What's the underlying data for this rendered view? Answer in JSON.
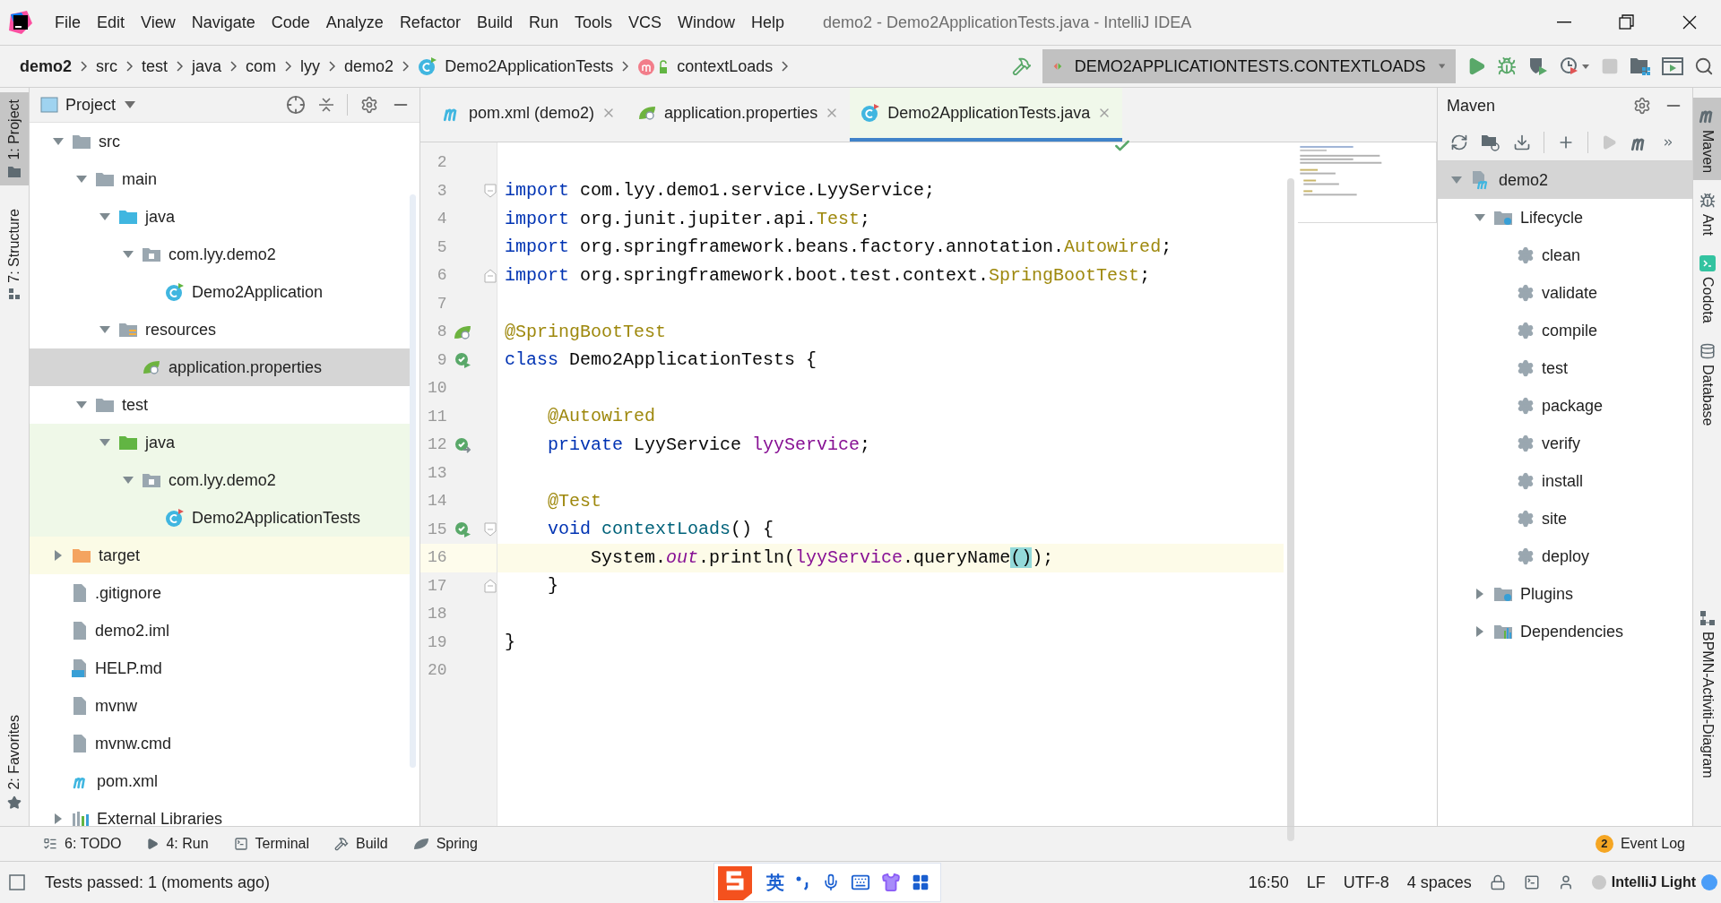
{
  "title_bar": {
    "title": "demo2 - Demo2ApplicationTests.java - IntelliJ IDEA"
  },
  "menu": [
    "File",
    "Edit",
    "View",
    "Navigate",
    "Code",
    "Analyze",
    "Refactor",
    "Build",
    "Run",
    "Tools",
    "VCS",
    "Window",
    "Help"
  ],
  "breadcrumbs": [
    {
      "label": "demo2",
      "kind": "project"
    },
    {
      "label": "src",
      "kind": "dir"
    },
    {
      "label": "test",
      "kind": "dir"
    },
    {
      "label": "java",
      "kind": "dir"
    },
    {
      "label": "com",
      "kind": "dir"
    },
    {
      "label": "lyy",
      "kind": "dir"
    },
    {
      "label": "demo2",
      "kind": "dir"
    },
    {
      "label": "Demo2ApplicationTests",
      "kind": "class"
    },
    {
      "label": "contextLoads",
      "kind": "method"
    }
  ],
  "run_config": {
    "label": "DEMO2APPLICATIONTESTS.CONTEXTLOADS"
  },
  "left_strip": [
    {
      "label": "1: Project",
      "kind": "project",
      "selected": true
    },
    {
      "label": "7: Structure",
      "kind": "structure",
      "selected": false
    },
    {
      "label": "2: Favorites",
      "kind": "favorites",
      "selected": false
    }
  ],
  "project_panel": {
    "title": "Project",
    "tree": [
      {
        "label": "src",
        "kind": "folder",
        "expanded": true,
        "selected": false,
        "children": [
          {
            "label": "main",
            "kind": "folder",
            "expanded": true,
            "selected": false,
            "children": [
              {
                "label": "java",
                "kind": "source-folder",
                "expanded": true,
                "selected": false,
                "children": [
                  {
                    "label": "com.lyy.demo2",
                    "kind": "package",
                    "expanded": true,
                    "selected": false,
                    "children": [
                      {
                        "label": "Demo2Application",
                        "kind": "class",
                        "selected": false
                      }
                    ]
                  }
                ]
              },
              {
                "label": "resources",
                "kind": "resources-folder",
                "expanded": true,
                "selected": false,
                "children": [
                  {
                    "label": "application.properties",
                    "kind": "properties",
                    "selected": true
                  }
                ]
              }
            ]
          },
          {
            "label": "test",
            "kind": "folder",
            "expanded": true,
            "selected": false,
            "children": [
              {
                "label": "java",
                "kind": "test-folder",
                "expanded": true,
                "selected": false,
                "children": [
                  {
                    "label": "com.lyy.demo2",
                    "kind": "test-package",
                    "expanded": true,
                    "selected": false,
                    "children": [
                      {
                        "label": "Demo2ApplicationTests",
                        "kind": "test-class",
                        "selected": false
                      }
                    ]
                  }
                ]
              }
            ]
          }
        ]
      },
      {
        "label": "target",
        "kind": "excluded-folder",
        "expanded": false,
        "selected": false
      },
      {
        "label": ".gitignore",
        "kind": "file",
        "selected": false
      },
      {
        "label": "demo2.iml",
        "kind": "file",
        "selected": false
      },
      {
        "label": "HELP.md",
        "kind": "markdown",
        "selected": false
      },
      {
        "label": "mvnw",
        "kind": "file",
        "selected": false
      },
      {
        "label": "mvnw.cmd",
        "kind": "file",
        "selected": false
      },
      {
        "label": "pom.xml",
        "kind": "maven",
        "selected": false
      },
      {
        "label": "External Libraries",
        "kind": "libraries",
        "expanded": false,
        "selected": false
      }
    ]
  },
  "editor": {
    "tabs": [
      {
        "label": "pom.xml (demo2)",
        "kind": "maven",
        "selected": false
      },
      {
        "label": "application.properties",
        "kind": "properties",
        "selected": false
      },
      {
        "label": "Demo2ApplicationTests.java",
        "kind": "class",
        "selected": true
      }
    ],
    "lines": [
      {
        "number": "2",
        "current": false
      },
      {
        "number": "3",
        "current": false,
        "fold_marker": {
          "kind": "start"
        },
        "tokens": [
          {
            "kind": "kw",
            "text": "import "
          },
          {
            "kind": "plain",
            "text": "com.lyy.demo1.service.LyyService;"
          }
        ]
      },
      {
        "number": "4",
        "current": false,
        "tokens": [
          {
            "kind": "kw",
            "text": "import "
          },
          {
            "kind": "plain",
            "text": "org.junit.jupiter.api."
          },
          {
            "kind": "ann",
            "text": "Test"
          },
          {
            "kind": "plain",
            "text": ";"
          }
        ]
      },
      {
        "number": "5",
        "current": false,
        "tokens": [
          {
            "kind": "kw",
            "text": "import "
          },
          {
            "kind": "plain",
            "text": "org.springframework.beans.factory.annotation."
          },
          {
            "kind": "ann",
            "text": "Autowired"
          },
          {
            "kind": "plain",
            "text": ";"
          }
        ]
      },
      {
        "number": "6",
        "current": false,
        "fold_marker": {
          "kind": "end"
        },
        "tokens": [
          {
            "kind": "kw",
            "text": "import "
          },
          {
            "kind": "plain",
            "text": "org.springframework.boot.test.context."
          },
          {
            "kind": "ann",
            "text": "SpringBootTest"
          },
          {
            "kind": "plain",
            "text": ";"
          }
        ]
      },
      {
        "number": "7",
        "current": false
      },
      {
        "number": "8",
        "current": false,
        "gutter_icon": {
          "kind": "bean"
        },
        "tokens": [
          {
            "kind": "ann",
            "text": "@SpringBootTest"
          }
        ]
      },
      {
        "number": "9",
        "current": false,
        "gutter_icon": {
          "kind": "run"
        },
        "tokens": [
          {
            "kind": "kw",
            "text": "class "
          },
          {
            "kind": "plain",
            "text": "Demo2ApplicationTests {"
          }
        ]
      },
      {
        "number": "10",
        "current": false
      },
      {
        "number": "11",
        "current": false,
        "tokens": [
          {
            "kind": "ann",
            "text": "    @Autowired"
          }
        ]
      },
      {
        "number": "12",
        "current": false,
        "gutter_icon": {
          "kind": "autowired"
        },
        "tokens": [
          {
            "kind": "kw",
            "text": "    private "
          },
          {
            "kind": "plain",
            "text": "LyyService "
          },
          {
            "kind": "field",
            "text": "lyyService"
          },
          {
            "kind": "plain",
            "text": ";"
          }
        ]
      },
      {
        "number": "13",
        "current": false
      },
      {
        "number": "14",
        "current": false,
        "tokens": [
          {
            "kind": "ann",
            "text": "    @Test"
          }
        ]
      },
      {
        "number": "15",
        "current": false,
        "gutter_icon": {
          "kind": "run"
        },
        "fold_marker": {
          "kind": "start"
        },
        "tokens": [
          {
            "kind": "kw",
            "text": "    void "
          },
          {
            "kind": "method",
            "text": "contextLoads"
          },
          {
            "kind": "plain",
            "text": "() {"
          }
        ]
      },
      {
        "number": "16",
        "current": true,
        "tokens": [
          {
            "kind": "plain",
            "text": "        System."
          },
          {
            "kind": "static",
            "text": "out"
          },
          {
            "kind": "plain",
            "text": ".println("
          },
          {
            "kind": "field",
            "text": "lyyService"
          },
          {
            "kind": "plain",
            "text": ".queryName"
          },
          {
            "kind": "match",
            "text": "()"
          },
          {
            "kind": "plain",
            "text": ");"
          }
        ]
      },
      {
        "number": "17",
        "current": false,
        "fold_marker": {
          "kind": "end"
        },
        "tokens": [
          {
            "kind": "plain",
            "text": "    }"
          }
        ]
      },
      {
        "number": "18",
        "current": false
      },
      {
        "number": "19",
        "current": false,
        "tokens": [
          {
            "kind": "plain",
            "text": "}"
          }
        ]
      },
      {
        "number": "20",
        "current": false
      }
    ]
  },
  "maven_panel": {
    "title": "Maven",
    "tree": [
      {
        "label": "demo2",
        "kind": "maven-project",
        "expanded": true,
        "selected": true,
        "children": [
          {
            "label": "Lifecycle",
            "kind": "settings-folder",
            "expanded": true,
            "selected": false,
            "children": [
              {
                "label": "clean",
                "kind": "goal",
                "selected": false
              },
              {
                "label": "validate",
                "kind": "goal",
                "selected": false
              },
              {
                "label": "compile",
                "kind": "goal",
                "selected": false
              },
              {
                "label": "test",
                "kind": "goal",
                "selected": false
              },
              {
                "label": "package",
                "kind": "goal",
                "selected": false
              },
              {
                "label": "verify",
                "kind": "goal",
                "selected": false
              },
              {
                "label": "install",
                "kind": "goal",
                "selected": false
              },
              {
                "label": "site",
                "kind": "goal",
                "selected": false
              },
              {
                "label": "deploy",
                "kind": "goal",
                "selected": false
              }
            ]
          },
          {
            "label": "Plugins",
            "kind": "settings-folder",
            "expanded": false,
            "selected": false
          },
          {
            "label": "Dependencies",
            "kind": "dependencies",
            "expanded": false,
            "selected": false
          }
        ]
      }
    ]
  },
  "right_strip": [
    {
      "label": "Maven",
      "kind": "maven",
      "selected": true
    },
    {
      "label": "Ant",
      "kind": "ant",
      "selected": false
    },
    {
      "label": "Codota",
      "kind": "codota",
      "selected": false
    },
    {
      "label": "Database",
      "kind": "database",
      "selected": false
    },
    {
      "label": "BPMN-Activiti-Diagram",
      "kind": "diagram",
      "selected": false
    }
  ],
  "bottom_tools": [
    {
      "label": "6: TODO",
      "kind": "todo"
    },
    {
      "label": "4: Run",
      "kind": "run"
    },
    {
      "label": "Terminal",
      "kind": "terminal"
    },
    {
      "label": "Build",
      "kind": "build"
    },
    {
      "label": "Spring",
      "kind": "spring"
    }
  ],
  "event_log": {
    "label": "Event Log",
    "badge": "2"
  },
  "status_bar": {
    "message": "Tests passed: 1 (moments ago)",
    "ime_mode": "英",
    "items": [
      "16:50",
      "LF",
      "UTF-8",
      "4 spaces"
    ],
    "theme": "IntelliJ Light"
  }
}
